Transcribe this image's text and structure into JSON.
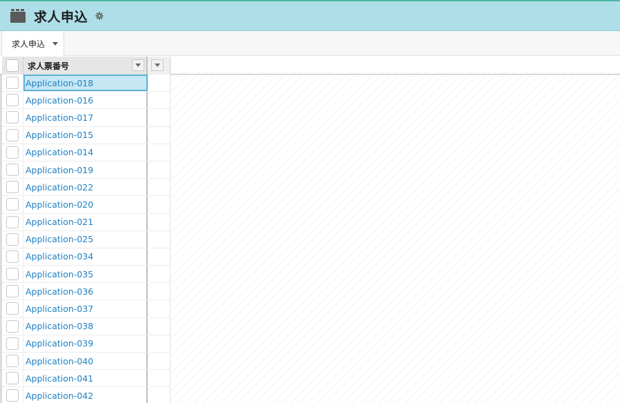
{
  "header": {
    "title": "求人申込",
    "app_icon": "folder-icon",
    "settings_icon": "gear-icon"
  },
  "view_tabs": [
    {
      "label": "求人申込",
      "has_dropdown": true
    }
  ],
  "grid": {
    "columns": [
      {
        "label": "求人票番号"
      }
    ],
    "selected_row": 0,
    "rows": [
      {
        "id": "Application-018"
      },
      {
        "id": "Application-016"
      },
      {
        "id": "Application-017"
      },
      {
        "id": "Application-015"
      },
      {
        "id": "Application-014"
      },
      {
        "id": "Application-019"
      },
      {
        "id": "Application-022"
      },
      {
        "id": "Application-020"
      },
      {
        "id": "Application-021"
      },
      {
        "id": "Application-025"
      },
      {
        "id": "Application-034"
      },
      {
        "id": "Application-035"
      },
      {
        "id": "Application-036"
      },
      {
        "id": "Application-037"
      },
      {
        "id": "Application-038"
      },
      {
        "id": "Application-039"
      },
      {
        "id": "Application-040"
      },
      {
        "id": "Application-041"
      },
      {
        "id": "Application-042"
      }
    ]
  },
  "colors": {
    "header_bg": "#aedfe8",
    "link": "#1e7fc4",
    "selected_bg": "#c7e7f4",
    "selected_border": "#5ab2d6"
  }
}
